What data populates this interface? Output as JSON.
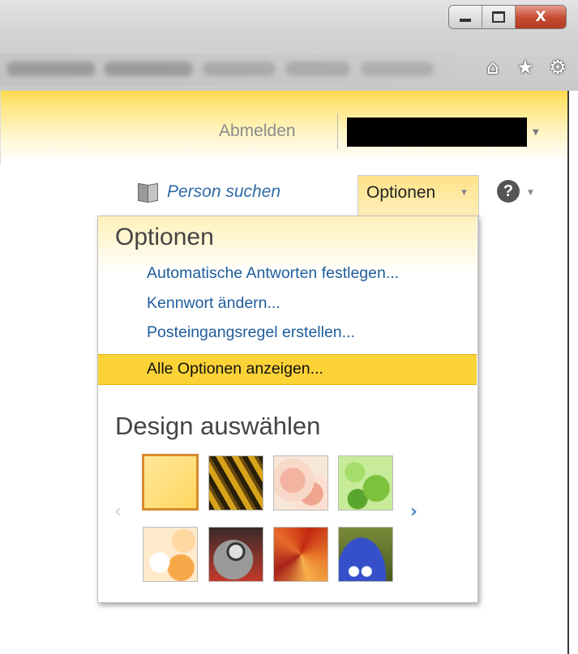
{
  "browser": {
    "window_buttons": {
      "minimize": "minimize",
      "maximize": "maximize",
      "close": "X"
    },
    "toolbar_icons": [
      "home-icon",
      "star-icon",
      "gear-icon"
    ]
  },
  "header": {
    "signout_label": "Abmelden"
  },
  "toolbar": {
    "find_person_label": "Person suchen",
    "options_label": "Optionen",
    "help_symbol": "?"
  },
  "menu": {
    "title": "Optionen",
    "links": [
      "Automatische Antworten festlegen...",
      "Kennwort ändern...",
      "Posteingangsregel erstellen..."
    ],
    "highlighted": "Alle Optionen anzeigen...",
    "design_title": "Design auswählen",
    "themes": [
      {
        "name": "theme-yellow",
        "selected": true
      },
      {
        "name": "theme-tiger",
        "selected": false
      },
      {
        "name": "theme-blossom",
        "selected": false
      },
      {
        "name": "theme-leaves",
        "selected": false
      },
      {
        "name": "theme-bubbles",
        "selected": false
      },
      {
        "name": "theme-robot",
        "selected": false
      },
      {
        "name": "theme-autumn",
        "selected": false
      },
      {
        "name": "theme-monster",
        "selected": false
      }
    ]
  },
  "colors": {
    "accent_yellow": "#fcd337",
    "link_blue": "#1e5c9c",
    "selected_border": "#d88a2c"
  }
}
